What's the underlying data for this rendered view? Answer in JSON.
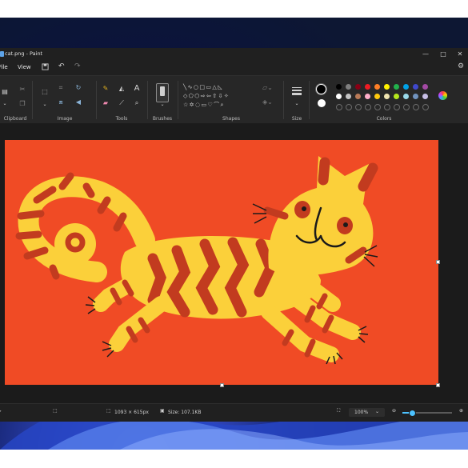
{
  "window": {
    "title": "cat.png - Paint",
    "controls": {
      "minimize": "—",
      "maximize": "□",
      "close": "✕"
    }
  },
  "menu": {
    "file": "File",
    "view": "View"
  },
  "ribbon": {
    "groups": [
      "Clipboard",
      "Image",
      "Tools",
      "Brushes",
      "Shapes",
      "Size",
      "Colors"
    ]
  },
  "colors": {
    "primary": "#000000",
    "secondary": "#ffffff",
    "palette_row1": [
      "#000000",
      "#7f7f7f",
      "#880015",
      "#ed1c24",
      "#ff7f27",
      "#fff200",
      "#22b14c",
      "#00a2e8",
      "#3f48cc",
      "#a349a4"
    ],
    "palette_row2": [
      "#ffffff",
      "#c3c3c3",
      "#b97a57",
      "#ffaec9",
      "#ffc90e",
      "#efe4b0",
      "#b5e61d",
      "#99d9ea",
      "#7092be",
      "#c8bfe7"
    ],
    "canvas_background": "#f04b25",
    "cat_body": "#fbd03a",
    "cat_stripes": "#c23b1f"
  },
  "status": {
    "dimensions": "1093 × 615px",
    "size": "Size: 107.1KB",
    "zoom": "100%"
  }
}
